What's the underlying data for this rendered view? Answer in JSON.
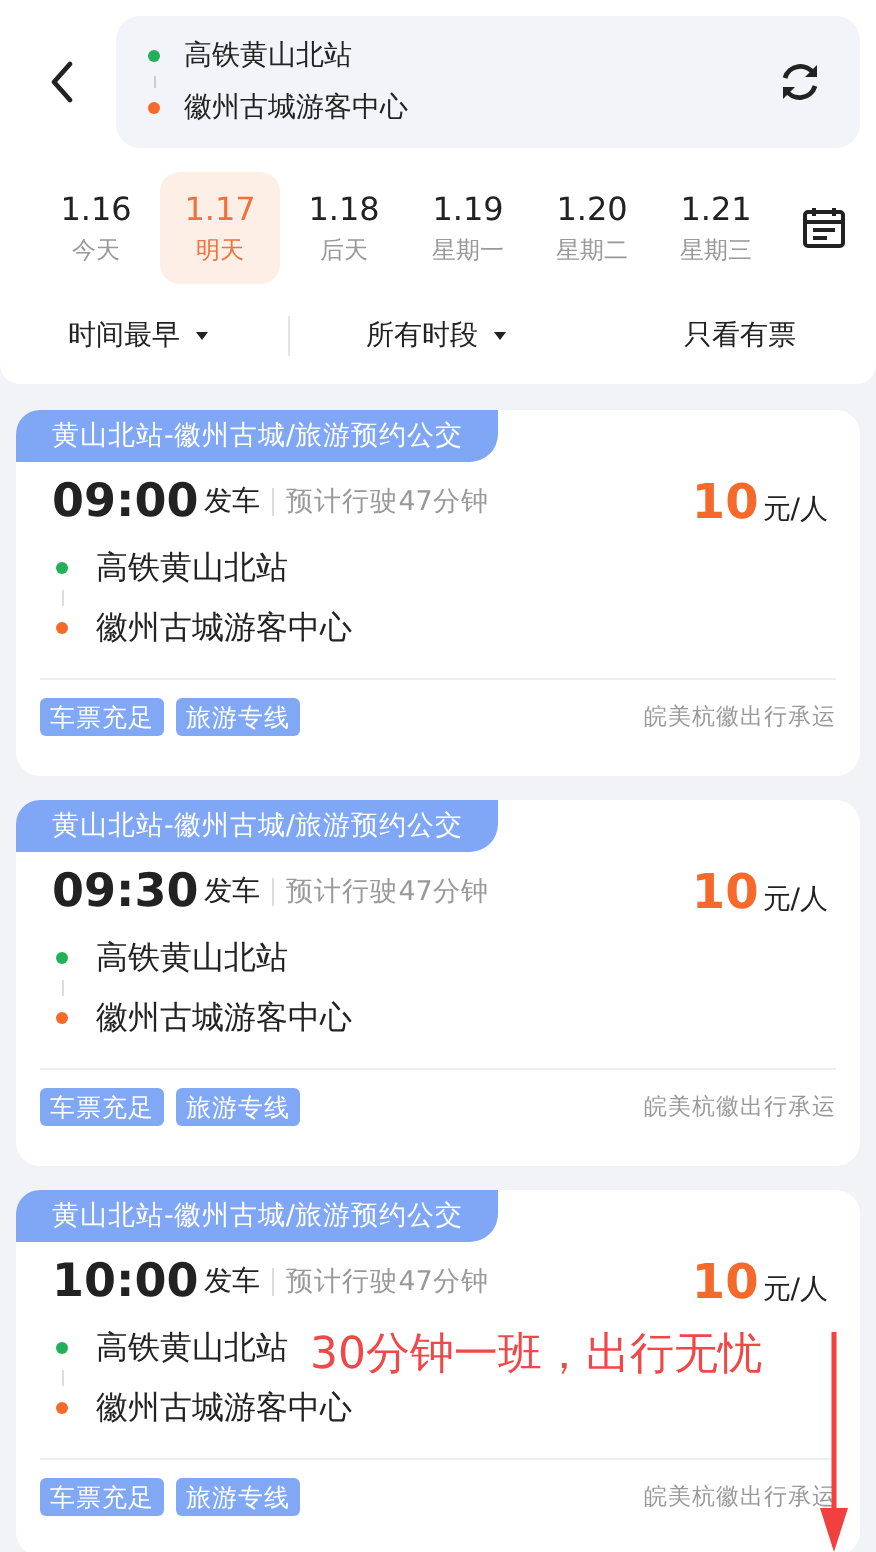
{
  "route": {
    "from": "高铁黄山北站",
    "to": "徽州古城游客中心"
  },
  "dates": [
    {
      "date": "1.16",
      "day": "今天",
      "selected": false
    },
    {
      "date": "1.17",
      "day": "明天",
      "selected": true
    },
    {
      "date": "1.18",
      "day": "后天",
      "selected": false
    },
    {
      "date": "1.19",
      "day": "星期一",
      "selected": false
    },
    {
      "date": "1.20",
      "day": "星期二",
      "selected": false
    },
    {
      "date": "1.21",
      "day": "星期三",
      "selected": false
    }
  ],
  "filters": [
    {
      "label": "时间最早",
      "kind": "dropdown"
    },
    {
      "label": "所有时段",
      "kind": "dropdown"
    },
    {
      "label": "只看有票",
      "kind": "toggle"
    }
  ],
  "trips": [
    {
      "line": "黄山北站-徽州古城/旅游预约公交",
      "time": "09:00",
      "depart": "发车",
      "duration": "预计行驶47分钟",
      "price": "10",
      "unit": "元/人",
      "from": "高铁黄山北站",
      "to": "徽州古城游客中心",
      "tags": [
        "车票充足",
        "旅游专线"
      ],
      "operator": "皖美杭徽出行承运"
    },
    {
      "line": "黄山北站-徽州古城/旅游预约公交",
      "time": "09:30",
      "depart": "发车",
      "duration": "预计行驶47分钟",
      "price": "10",
      "unit": "元/人",
      "from": "高铁黄山北站",
      "to": "徽州古城游客中心",
      "tags": [
        "车票充足",
        "旅游专线"
      ],
      "operator": "皖美杭徽出行承运"
    },
    {
      "line": "黄山北站-徽州古城/旅游预约公交",
      "time": "10:00",
      "depart": "发车",
      "duration": "预计行驶47分钟",
      "price": "10",
      "unit": "元/人",
      "from": "高铁黄山北站",
      "to": "徽州古城游客中心",
      "tags": [
        "车票充足",
        "旅游专线"
      ],
      "operator": "皖美杭徽出行承运"
    }
  ],
  "annotation": {
    "text": "30分钟一班，出行无忧"
  }
}
